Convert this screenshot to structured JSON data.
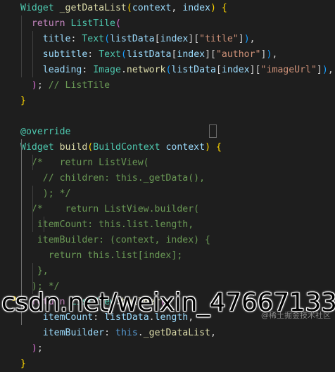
{
  "code_lines": [
    {
      "segs": [
        [
          "cls",
          "Widget"
        ],
        [
          "plain",
          " "
        ],
        [
          "fn",
          "_getDataList"
        ],
        [
          "br1",
          "("
        ],
        [
          "var",
          "context"
        ],
        [
          "plain",
          ", "
        ],
        [
          "var",
          "index"
        ],
        [
          "br1",
          ")"
        ],
        [
          "plain",
          " "
        ],
        [
          "br1",
          "{"
        ]
      ]
    },
    {
      "segs": [
        [
          "plain",
          "  "
        ],
        [
          "kw",
          "return"
        ],
        [
          "plain",
          " "
        ],
        [
          "cls",
          "ListTile"
        ],
        [
          "br2",
          "("
        ]
      ]
    },
    {
      "segs": [
        [
          "plain",
          "    "
        ],
        [
          "var",
          "title"
        ],
        [
          "plain",
          ": "
        ],
        [
          "cls",
          "Text"
        ],
        [
          "br3",
          "("
        ],
        [
          "var",
          "listData"
        ],
        [
          "plain",
          "["
        ],
        [
          "var",
          "index"
        ],
        [
          "plain",
          "]["
        ],
        [
          "str",
          "\"title\""
        ],
        [
          "plain",
          "]"
        ],
        [
          "br3",
          ")"
        ],
        [
          "plain",
          ","
        ]
      ]
    },
    {
      "segs": [
        [
          "plain",
          "    "
        ],
        [
          "var",
          "subtitle"
        ],
        [
          "plain",
          ": "
        ],
        [
          "cls",
          "Text"
        ],
        [
          "br3",
          "("
        ],
        [
          "var",
          "listData"
        ],
        [
          "plain",
          "["
        ],
        [
          "var",
          "index"
        ],
        [
          "plain",
          "]["
        ],
        [
          "str",
          "\"author\""
        ],
        [
          "plain",
          "]"
        ],
        [
          "br3",
          ")"
        ],
        [
          "plain",
          ","
        ]
      ]
    },
    {
      "segs": [
        [
          "plain",
          "    "
        ],
        [
          "var",
          "leading"
        ],
        [
          "plain",
          ": "
        ],
        [
          "cls",
          "Image"
        ],
        [
          "plain",
          "."
        ],
        [
          "fn",
          "network"
        ],
        [
          "br3",
          "("
        ],
        [
          "var",
          "listData"
        ],
        [
          "plain",
          "["
        ],
        [
          "var",
          "index"
        ],
        [
          "plain",
          "]["
        ],
        [
          "str",
          "\"imageUrl\""
        ],
        [
          "plain",
          "]"
        ],
        [
          "br3",
          ")"
        ],
        [
          "plain",
          ","
        ]
      ]
    },
    {
      "segs": [
        [
          "plain",
          "  "
        ],
        [
          "br2",
          ")"
        ],
        [
          "plain",
          "; "
        ],
        [
          "cm",
          "// ListTile"
        ]
      ]
    },
    {
      "segs": [
        [
          "br1",
          "}"
        ]
      ]
    },
    {
      "segs": [
        [
          "plain",
          ""
        ]
      ]
    },
    {
      "segs": [
        [
          "cls",
          "@override"
        ]
      ]
    },
    {
      "segs": [
        [
          "cls",
          "Widget"
        ],
        [
          "plain",
          " "
        ],
        [
          "fn",
          "build"
        ],
        [
          "br1",
          "("
        ],
        [
          "cls",
          "BuildContext"
        ],
        [
          "plain",
          " "
        ],
        [
          "var",
          "context"
        ],
        [
          "br1",
          ")"
        ],
        [
          "plain",
          " "
        ],
        [
          "br1",
          "{"
        ]
      ]
    },
    {
      "segs": [
        [
          "plain",
          "  "
        ],
        [
          "cm",
          "/*   return ListView("
        ]
      ]
    },
    {
      "segs": [
        [
          "plain",
          "    "
        ],
        [
          "cm",
          "// children: this._getData(),"
        ]
      ]
    },
    {
      "segs": [
        [
          "plain",
          "    "
        ],
        [
          "cm",
          "); */"
        ]
      ]
    },
    {
      "segs": [
        [
          "plain",
          "  "
        ],
        [
          "cm",
          "/*    return ListView.builder("
        ]
      ]
    },
    {
      "segs": [
        [
          "plain",
          "   "
        ],
        [
          "cm",
          "itemCount: this.list.length,"
        ]
      ]
    },
    {
      "segs": [
        [
          "plain",
          "   "
        ],
        [
          "cm",
          "itemBuilder: (context, index) {"
        ]
      ]
    },
    {
      "segs": [
        [
          "plain",
          "     "
        ],
        [
          "cm",
          "return this.list[index];"
        ]
      ]
    },
    {
      "segs": [
        [
          "plain",
          "   "
        ],
        [
          "cm",
          "},"
        ]
      ]
    },
    {
      "segs": [
        [
          "plain",
          "  "
        ],
        [
          "cm",
          "); */"
        ]
      ]
    },
    {
      "segs": [
        [
          "plain",
          "  "
        ],
        [
          "kw",
          "return"
        ],
        [
          "plain",
          " "
        ],
        [
          "cls",
          "ListView"
        ],
        [
          "plain",
          "."
        ],
        [
          "fn",
          "builder"
        ],
        [
          "br2",
          "("
        ]
      ]
    },
    {
      "segs": [
        [
          "plain",
          "    "
        ],
        [
          "var",
          "itemCount"
        ],
        [
          "plain",
          ": "
        ],
        [
          "var",
          "listData"
        ],
        [
          "plain",
          "."
        ],
        [
          "var",
          "length"
        ],
        [
          "plain",
          ","
        ]
      ]
    },
    {
      "segs": [
        [
          "plain",
          "    "
        ],
        [
          "var",
          "itemBuilder"
        ],
        [
          "plain",
          ": "
        ],
        [
          "kw2",
          "this"
        ],
        [
          "plain",
          "."
        ],
        [
          "fn",
          "_getDataList"
        ],
        [
          "plain",
          ","
        ]
      ]
    },
    {
      "segs": [
        [
          "plain",
          "  "
        ],
        [
          "br2",
          ")"
        ],
        [
          "plain",
          ";"
        ]
      ]
    },
    {
      "segs": [
        [
          "br1",
          "}"
        ]
      ]
    }
  ],
  "watermark_text": "csdn.net/weixin_47667133",
  "juejin_text": "@稀土掘金技术社区",
  "colors": {
    "background": "#1e1e1e",
    "keyword": "#c586c0",
    "type": "#4ec9b0",
    "function": "#dcdcaa",
    "string": "#ce9178",
    "variable": "#9cdcfe",
    "comment": "#6a9955"
  }
}
